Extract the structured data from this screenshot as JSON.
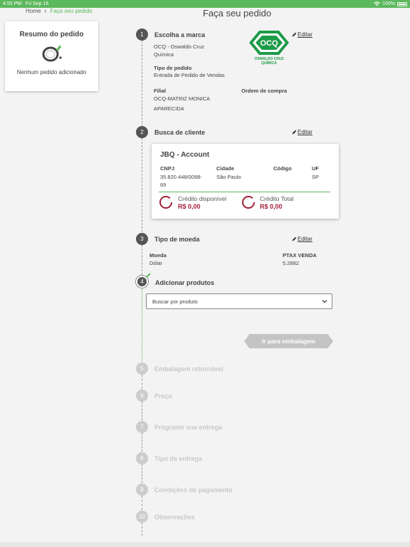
{
  "status": {
    "time": "4:55 PM",
    "date": "Fri Sep 16",
    "battery": "100%"
  },
  "breadcrumb": {
    "home": "Home",
    "current": "Faça seu pedido"
  },
  "page_title": "Faça seu pedido",
  "summary": {
    "title": "Resumo do pedido",
    "empty_text": "Nenhum pedido adicionado"
  },
  "edit_label": "Editar",
  "brand_logo": {
    "text": "OCQ",
    "caption_line1": "OSWALDO CRUZ",
    "caption_line2": "QUÍMICA"
  },
  "steps": [
    {
      "number": "1",
      "title": "Escolha a marca"
    },
    {
      "number": "2",
      "title": "Busca de cliente"
    },
    {
      "number": "3",
      "title": "Tipo de moeda"
    },
    {
      "number": "4",
      "title": "Adicionar produtos"
    },
    {
      "number": "5",
      "title": "Embalagem retornável"
    },
    {
      "number": "6",
      "title": "Preço"
    },
    {
      "number": "7",
      "title": "Programe sua entrega"
    },
    {
      "number": "8",
      "title": "Tipo da entrega"
    },
    {
      "number": "9",
      "title": "Condições de pagamento"
    },
    {
      "number": "10",
      "title": "Observações"
    }
  ],
  "step1": {
    "brand_line1": "OCQ - Oswaldo Cruz",
    "brand_line2": "Química",
    "order_type_label": "Tipo de pedido",
    "order_type_value": "Entrada de Pedido de Vendas",
    "branch_label": "Filial",
    "branch_line1": "OCQ-MATRIZ MONICA",
    "branch_line2": "APARECIDA",
    "purchase_order_label": "Ordem de compra"
  },
  "client": {
    "name": "JBQ - Account",
    "cnpj_label": "CNPJ",
    "cnpj_line1": "35.820.448/0098-",
    "cnpj_line2": "69",
    "city_label": "Cidade",
    "city_value": "São Paulo",
    "code_label": "Código",
    "uf_label": "UF",
    "uf_value": "SP",
    "credit_available_label": "Crédito disponível",
    "credit_available_value": "R$ 0,00",
    "credit_total_label": "Crédito Total",
    "credit_total_value": "R$ 0,00"
  },
  "currency": {
    "label": "Moeda",
    "value": "Dólar",
    "ptax_label": "PTAX VENDA",
    "ptax_value": "5.2882"
  },
  "products": {
    "search_placeholder": "Buscar por produto"
  },
  "next_button": "Ir para embalagem",
  "colors": {
    "accent": "#5cb85c",
    "credit": "#a3203a",
    "step_active": "#555555",
    "step_inactive": "#cccccc"
  }
}
